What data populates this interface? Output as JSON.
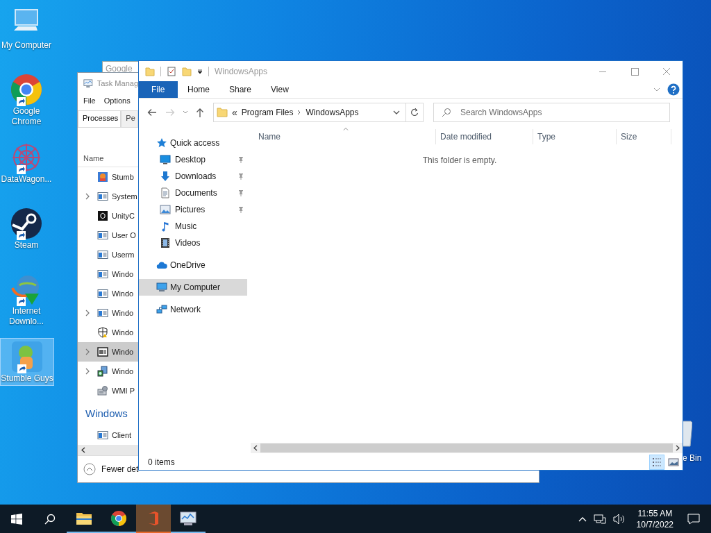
{
  "desktop": {
    "icons": [
      {
        "label": "My Computer",
        "kind": "computer",
        "shortcut": false,
        "selected": false
      },
      {
        "label": "Google Chrome",
        "kind": "chrome",
        "shortcut": true,
        "selected": false
      },
      {
        "label": "DataWagon...",
        "kind": "datawagon",
        "shortcut": true,
        "selected": false
      },
      {
        "label": "Steam",
        "kind": "steam",
        "shortcut": true,
        "selected": false
      },
      {
        "label": "Internet Downlo...",
        "kind": "downloader",
        "shortcut": true,
        "selected": false
      },
      {
        "label": "Stumble Guys",
        "kind": "game",
        "shortcut": true,
        "selected": true
      }
    ],
    "recycle_bin": {
      "label": "e Bin"
    }
  },
  "background_window": {
    "title": "Google"
  },
  "task_manager": {
    "title": "Task Manag",
    "menu": [
      "File",
      "Options"
    ],
    "tabs": [
      {
        "label": "Processes",
        "selected": true
      },
      {
        "label": "Pe",
        "selected": false
      }
    ],
    "column": "Name",
    "rows": [
      {
        "name": "Stumb",
        "kind": "game",
        "expandable": false,
        "selected": false
      },
      {
        "name": "System",
        "kind": "window",
        "expandable": true,
        "selected": false
      },
      {
        "name": "UnityC",
        "kind": "unity",
        "expandable": false,
        "selected": false
      },
      {
        "name": "User O",
        "kind": "window",
        "expandable": false,
        "selected": false
      },
      {
        "name": "Userm",
        "kind": "window",
        "expandable": false,
        "selected": false
      },
      {
        "name": "Windo",
        "kind": "window",
        "expandable": false,
        "selected": false
      },
      {
        "name": "Windo",
        "kind": "window",
        "expandable": false,
        "selected": false
      },
      {
        "name": "Windo",
        "kind": "window",
        "expandable": true,
        "selected": false
      },
      {
        "name": "Windo",
        "kind": "shield",
        "expandable": false,
        "selected": false
      },
      {
        "name": "Windo",
        "kind": "monitor",
        "expandable": true,
        "selected": true
      },
      {
        "name": "Windo",
        "kind": "installer",
        "expandable": true,
        "selected": false
      },
      {
        "name": "WMI P",
        "kind": "wmi",
        "expandable": false,
        "selected": false
      },
      {
        "name": "Windows",
        "kind": "group"
      },
      {
        "name": "Client",
        "kind": "window",
        "expandable": false,
        "selected": false
      }
    ],
    "footer": "Fewer det"
  },
  "explorer": {
    "title": "WindowsApps",
    "ribbon_tabs": [
      {
        "label": "File",
        "kind": "file"
      },
      {
        "label": "Home",
        "kind": "tab"
      },
      {
        "label": "Share",
        "kind": "tab"
      },
      {
        "label": "View",
        "kind": "tab"
      }
    ],
    "address": {
      "overflow": "«",
      "path": [
        "Program Files",
        "WindowsApps"
      ]
    },
    "search": {
      "placeholder": "Search WindowsApps"
    },
    "nav": [
      {
        "label": "Quick access",
        "kind": "star",
        "pinned": false,
        "selected": false,
        "children": [
          {
            "label": "Desktop",
            "kind": "desktop",
            "pinned": true,
            "selected": false
          },
          {
            "label": "Downloads",
            "kind": "download",
            "pinned": true,
            "selected": false
          },
          {
            "label": "Documents",
            "kind": "documents",
            "pinned": true,
            "selected": false
          },
          {
            "label": "Pictures",
            "kind": "pictures",
            "pinned": true,
            "selected": false
          },
          {
            "label": "Music",
            "kind": "music",
            "pinned": false,
            "selected": false
          },
          {
            "label": "Videos",
            "kind": "videos",
            "pinned": false,
            "selected": false
          }
        ]
      },
      {
        "label": "OneDrive",
        "kind": "cloud",
        "pinned": false,
        "selected": false
      },
      {
        "label": "My Computer",
        "kind": "computer",
        "pinned": false,
        "selected": true
      },
      {
        "label": "Network",
        "kind": "network",
        "pinned": false,
        "selected": false
      }
    ],
    "columns": [
      {
        "label": "Name",
        "sorted": true
      },
      {
        "label": "Date modified",
        "sorted": false
      },
      {
        "label": "Type",
        "sorted": false
      },
      {
        "label": "Size",
        "sorted": false
      }
    ],
    "empty_message": "This folder is empty.",
    "status": "0 items",
    "views": [
      {
        "kind": "details",
        "selected": true
      },
      {
        "kind": "thumbnails",
        "selected": false
      }
    ]
  },
  "taskbar": {
    "apps": [
      {
        "kind": "folder",
        "running": true,
        "active": false
      },
      {
        "kind": "chrome",
        "running": true,
        "active": false
      },
      {
        "kind": "office",
        "running": true,
        "active": true
      },
      {
        "kind": "taskmgr",
        "running": true,
        "active": false
      }
    ],
    "time": "11:55 AM",
    "date": "10/7/2022"
  }
}
